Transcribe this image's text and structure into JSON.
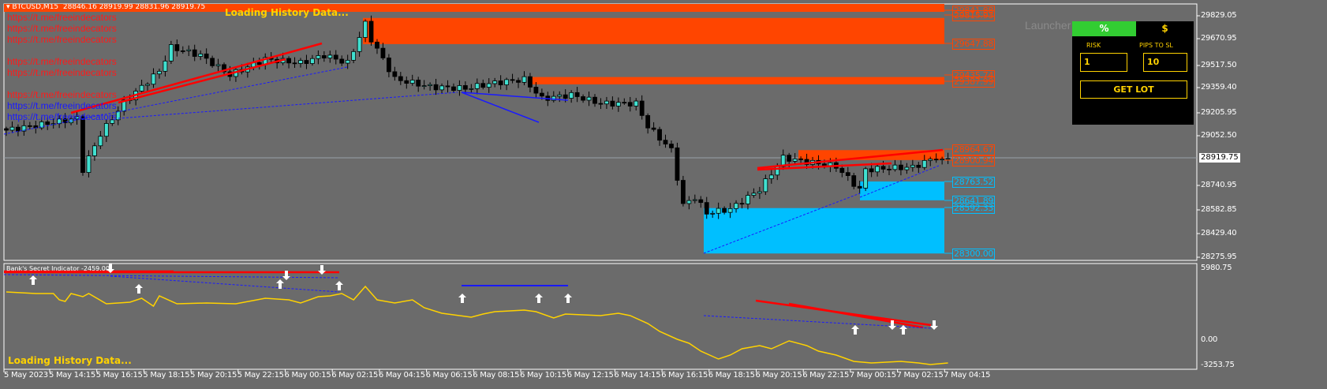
{
  "header": {
    "symbol": "BTCUSD,M15",
    "ohlc": "28846.16 28919.99 28831.96 28919.75",
    "loading": "Loading History Data..."
  },
  "links": [
    {
      "text": "https://t.me/freeindecators",
      "color": "red"
    },
    {
      "text": "https://t.me/freeindecators",
      "color": "red"
    },
    {
      "text": "https://t.me/freeindecators",
      "color": "red"
    },
    {
      "text": "https://t.me/freeindecators",
      "color": "red"
    },
    {
      "text": "https://t.me/freeindecators",
      "color": "red"
    },
    {
      "text": "https://t.me/freeindecators",
      "color": "red"
    },
    {
      "text": "https://t.me/freeindecators",
      "color": "blue"
    },
    {
      "text": "https://t.me/freeindecators",
      "color": "blue"
    }
  ],
  "price_axis": [
    "29829.05",
    "29670.95",
    "29517.50",
    "29359.40",
    "29205.95",
    "29052.50",
    "28740.95",
    "28582.85",
    "28429.40",
    "28275.95"
  ],
  "current_price": "28919.75",
  "zone_labels": [
    {
      "text": "29841.88",
      "type": "supply"
    },
    {
      "text": "29815.93",
      "type": "supply"
    },
    {
      "text": "29647.88",
      "type": "supply"
    },
    {
      "text": "29435.74",
      "type": "supply"
    },
    {
      "text": "29387.99",
      "type": "supply"
    },
    {
      "text": "28964.67",
      "type": "supply"
    },
    {
      "text": "28900.94",
      "type": "supply"
    },
    {
      "text": "28763.52",
      "type": "demand"
    },
    {
      "text": "28641.89",
      "type": "demand"
    },
    {
      "text": "28592.33",
      "type": "demand"
    },
    {
      "text": "28300.00",
      "type": "demand"
    }
  ],
  "price_anchors": [
    [
      0,
      29093
    ],
    [
      6,
      29130
    ],
    [
      12,
      29169
    ],
    [
      13,
      28839
    ],
    [
      16,
      29068
    ],
    [
      20,
      29271
    ],
    [
      26,
      29474
    ],
    [
      28,
      29626
    ],
    [
      33,
      29575
    ],
    [
      38,
      29448
    ],
    [
      44,
      29550
    ],
    [
      50,
      29525
    ],
    [
      54,
      29575
    ],
    [
      58,
      29525
    ],
    [
      61,
      29778
    ],
    [
      62,
      29677
    ],
    [
      66,
      29423
    ],
    [
      72,
      29372
    ],
    [
      78,
      29362
    ],
    [
      83,
      29398
    ],
    [
      88,
      29420
    ],
    [
      91,
      29296
    ],
    [
      96,
      29321
    ],
    [
      101,
      29265
    ],
    [
      107,
      29265
    ],
    [
      109,
      29118
    ],
    [
      113,
      28966
    ],
    [
      115,
      28611
    ],
    [
      117,
      28662
    ],
    [
      119,
      28560
    ],
    [
      123,
      28586
    ],
    [
      128,
      28712
    ],
    [
      132,
      28916
    ],
    [
      136,
      28890
    ],
    [
      141,
      28860
    ],
    [
      145,
      28712
    ],
    [
      146,
      28839
    ],
    [
      150,
      28850
    ],
    [
      154,
      28855
    ],
    [
      158,
      28920
    ],
    [
      159,
      28890
    ],
    [
      160,
      28919
    ]
  ],
  "indicator": {
    "title": "Bank's Secret Indicator -2459.00",
    "axis": [
      "5980.75",
      "0.00",
      "-3253.75"
    ],
    "loading": "Loading History Data...",
    "series": [
      [
        0,
        3653
      ],
      [
        5,
        3503
      ],
      [
        8,
        3503
      ],
      [
        9,
        2902
      ],
      [
        10,
        2752
      ],
      [
        11,
        3503
      ],
      [
        13,
        3203
      ],
      [
        14,
        3503
      ],
      [
        17,
        2527
      ],
      [
        21,
        2677
      ],
      [
        23,
        3053
      ],
      [
        25,
        2302
      ],
      [
        26,
        3278
      ],
      [
        29,
        2527
      ],
      [
        34,
        2602
      ],
      [
        39,
        2527
      ],
      [
        44,
        3053
      ],
      [
        48,
        2902
      ],
      [
        50,
        2602
      ],
      [
        53,
        3203
      ],
      [
        55,
        3278
      ],
      [
        57,
        3503
      ],
      [
        59,
        2902
      ],
      [
        61,
        4179
      ],
      [
        63,
        2902
      ],
      [
        66,
        2602
      ],
      [
        69,
        2902
      ],
      [
        71,
        2152
      ],
      [
        74,
        1626
      ],
      [
        77,
        1401
      ],
      [
        79,
        1251
      ],
      [
        81,
        1551
      ],
      [
        83,
        1776
      ],
      [
        88,
        1927
      ],
      [
        90,
        1776
      ],
      [
        93,
        1176
      ],
      [
        95,
        1551
      ],
      [
        101,
        1401
      ],
      [
        104,
        1626
      ],
      [
        106,
        1401
      ],
      [
        109,
        650
      ],
      [
        111,
        -100
      ],
      [
        114,
        -851
      ],
      [
        116,
        -1226
      ],
      [
        118,
        -1977
      ],
      [
        121,
        -2728
      ],
      [
        123,
        -2352
      ],
      [
        125,
        -1752
      ],
      [
        128,
        -1452
      ],
      [
        130,
        -1752
      ],
      [
        133,
        -1001
      ],
      [
        136,
        -1452
      ],
      [
        138,
        -1977
      ],
      [
        141,
        -2352
      ],
      [
        144,
        -2953
      ],
      [
        147,
        -3103
      ],
      [
        152,
        -2953
      ],
      [
        155,
        -3103
      ],
      [
        157,
        -3254
      ],
      [
        160,
        -3103
      ]
    ]
  },
  "time_axis": [
    "5 May 2023",
    "5 May 14:15",
    "5 May 16:15",
    "5 May 18:15",
    "5 May 20:15",
    "5 May 22:15",
    "6 May 00:15",
    "6 May 02:15",
    "6 May 04:15",
    "6 May 06:15",
    "6 May 08:15",
    "6 May 10:15",
    "6 May 12:15",
    "6 May 14:15",
    "6 May 16:15",
    "6 May 18:15",
    "6 May 20:15",
    "6 May 22:15",
    "7 May 00:15",
    "7 May 02:15",
    "7 May 04:15"
  ],
  "launcher": {
    "title": "Launcher",
    "tab_percent": "%",
    "tab_dollar": "$",
    "risk_label": "RISK",
    "pips_label": "PIPS TO SL",
    "risk_value": "1",
    "pips_value": "10",
    "button": "GET LOT"
  },
  "colors": {
    "bg": "#6b6b6b",
    "supply": "#ff4500",
    "demand": "#00bfff",
    "bull": "#40e0d0",
    "bear": "#000000",
    "indicator": "#ffd200"
  }
}
